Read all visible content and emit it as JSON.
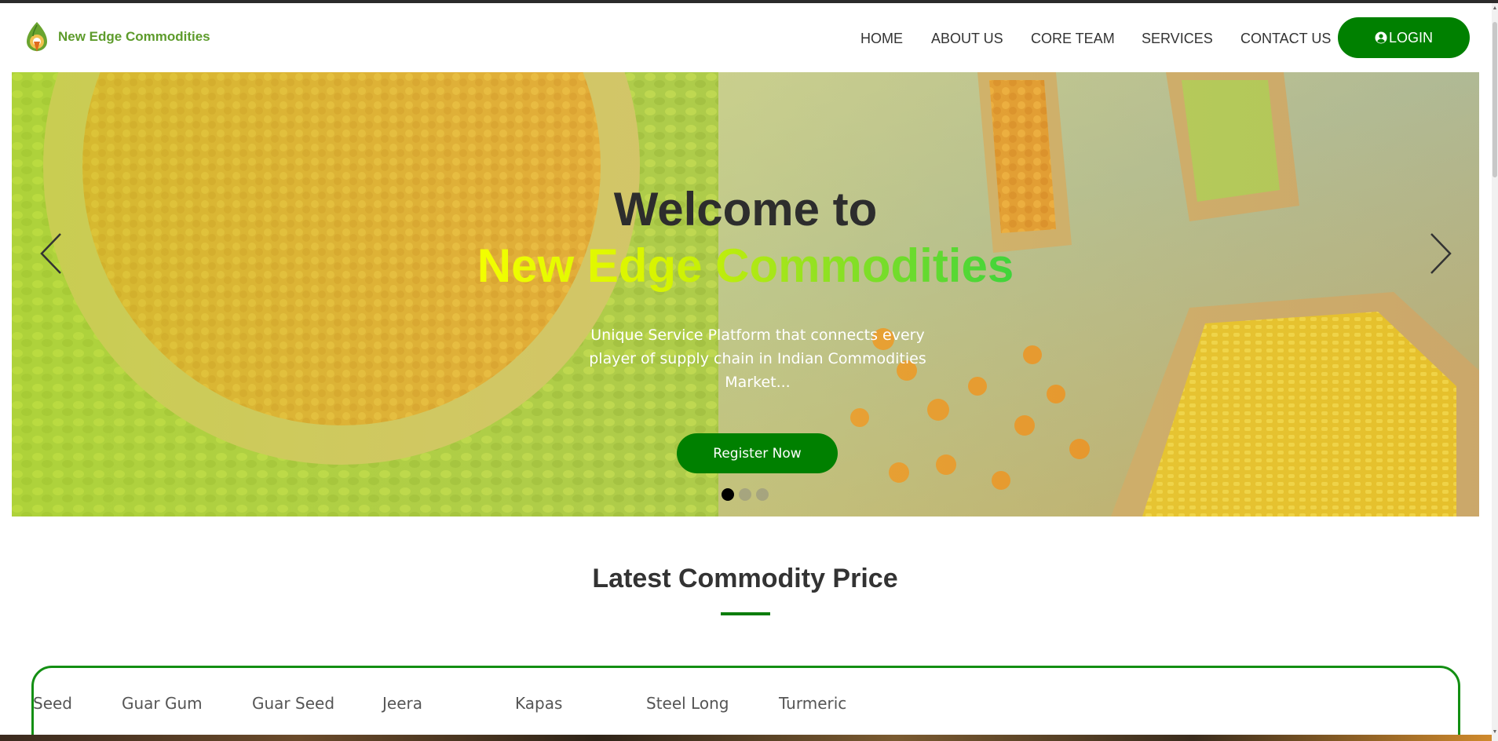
{
  "header": {
    "brand": "New Edge Commodities",
    "nav": [
      {
        "label": "HOME"
      },
      {
        "label": "ABOUT US"
      },
      {
        "label": "CORE TEAM"
      },
      {
        "label": "SERVICES"
      },
      {
        "label": "CONTACT US"
      }
    ],
    "login_label": "LOGIN"
  },
  "hero": {
    "title_line1": "Welcome to",
    "title_line2": "New Edge Commodities",
    "subtitle": "Unique Service Platform that connects every player of supply chain in Indian Commodities Market...",
    "cta_label": "Register Now",
    "slides_count": 3,
    "active_slide": 1
  },
  "prices": {
    "section_title": "Latest Commodity Price",
    "ticker": [
      "Seed",
      "Guar Gum",
      "Guar Seed",
      "Jeera",
      "Kapas",
      "Steel Long",
      "Turmeric"
    ]
  },
  "colors": {
    "brand_green": "#008000",
    "logo_green": "#5d9b2b",
    "box_border": "#138f13"
  },
  "icons": [
    "user-circle-icon",
    "chevron-left-icon",
    "chevron-right-icon",
    "brand-logo-icon"
  ]
}
